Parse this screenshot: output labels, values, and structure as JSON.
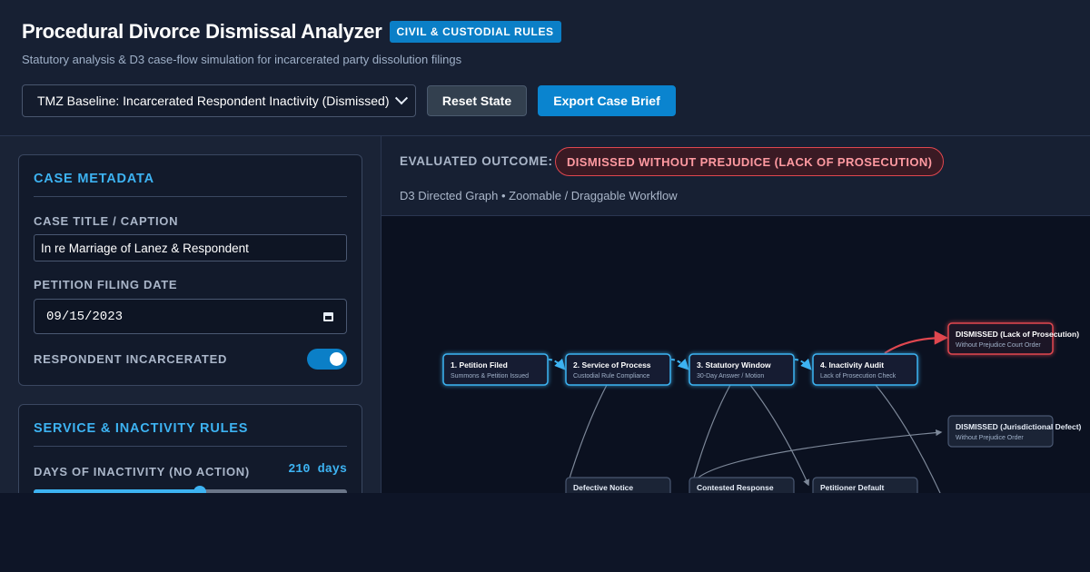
{
  "header": {
    "title": "Procedural Divorce Dismissal Analyzer",
    "badge": "CIVIL & CUSTODIAL RULES",
    "subtitle": "Statutory analysis & D3 case-flow simulation for incarcerated party dissolution filings"
  },
  "controls": {
    "scenario_selected": "TMZ Baseline: Incarcerated Respondent Inactivity (Dismissed)",
    "reset_label": "Reset State",
    "export_label": "Export Case Brief"
  },
  "case_metadata": {
    "title": "CASE METADATA",
    "caption_label": "CASE TITLE / CAPTION",
    "caption_value": "In re Marriage of Lanez & Respondent",
    "filing_date_label": "PETITION FILING DATE",
    "filing_date_value": "09/15/2023",
    "incarcerated_label": "RESPONDENT INCARCERATED",
    "incarcerated_on": true
  },
  "rules": {
    "title": "SERVICE & INACTIVITY RULES",
    "days_label": "DAYS OF INACTIVITY (NO ACTION)",
    "days_value": "210 days",
    "days_fraction": 0.53
  },
  "outcome": {
    "label": "EVALUATED OUTCOME:",
    "value": "DISMISSED WITHOUT PREJUDICE (LACK OF PROSECUTION)",
    "caption": "D3 Directed Graph • Zoomable / Draggable Workflow"
  },
  "graph": {
    "colors": {
      "active": "#3db3f2",
      "dismissed": "#e0474f",
      "muted": "#7d8899"
    },
    "nodes": [
      {
        "id": "n1",
        "title": "1. Petition Filed",
        "sub": "Summons & Petition Issued"
      },
      {
        "id": "n2",
        "title": "2. Service of Process",
        "sub": "Custodial Rule Compliance"
      },
      {
        "id": "n3",
        "title": "3. Statutory Window",
        "sub": "30-Day Answer / Motion"
      },
      {
        "id": "n4",
        "title": "4. Inactivity Audit",
        "sub": "Lack of Prosecution Check"
      },
      {
        "id": "d1",
        "title": "DISMISSED (Lack of Prosecution)",
        "sub": "Without Prejudice Court Order"
      },
      {
        "id": "d2",
        "title": "DISMISSED (Jurisdictional Defect)",
        "sub": "Without Prejudice Order"
      },
      {
        "id": "b1",
        "title": "Defective Notice",
        "sub": ""
      },
      {
        "id": "b2",
        "title": "Contested Response",
        "sub": ""
      },
      {
        "id": "b3",
        "title": "Petitioner Default",
        "sub": ""
      }
    ]
  }
}
